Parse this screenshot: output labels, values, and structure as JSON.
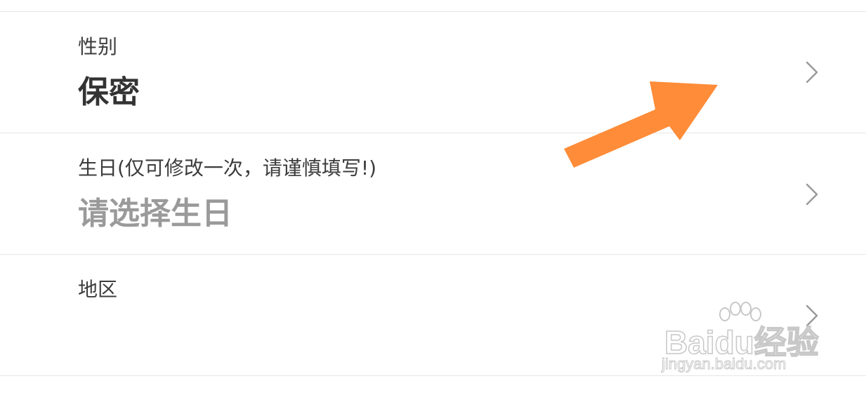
{
  "rows": [
    {
      "label": "性别",
      "value": "保密",
      "value_state": "filled"
    },
    {
      "label": "生日(仅可修改一次，请谨慎填写!)",
      "value": "请选择生日",
      "value_state": "placeholder"
    },
    {
      "label": "地区",
      "value": "",
      "value_state": "empty"
    }
  ],
  "icons": {
    "row_chevron": "chevron-right-icon",
    "annotation": "orange-arrow-icon"
  },
  "colors": {
    "label": "#3c3c3c",
    "value_filled": "#333333",
    "value_placeholder": "#9a9a9a",
    "chevron": "#9a9a9a",
    "divider": "#e6e6e6",
    "annotation_arrow": "#ff8c38"
  },
  "watermark": {
    "brand": "Baidu经验",
    "url": "jingyan.baidu.com"
  }
}
